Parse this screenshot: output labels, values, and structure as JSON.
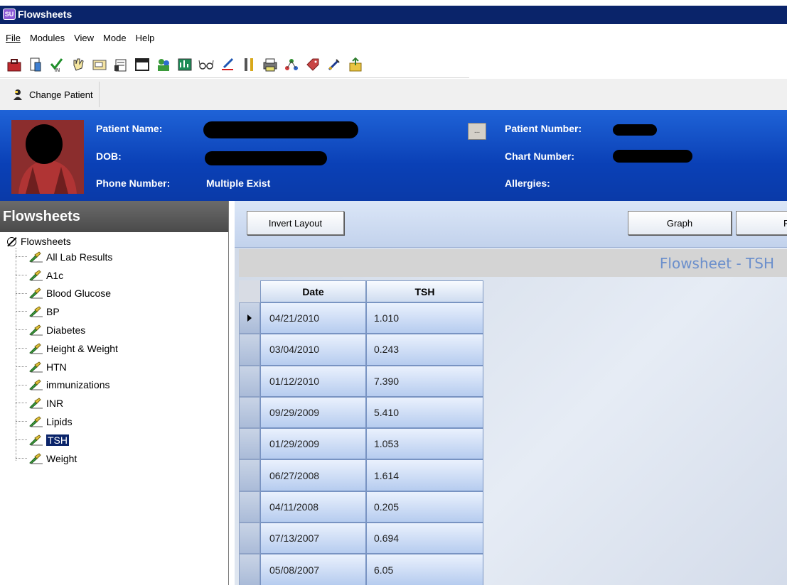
{
  "window": {
    "title": "Flowsheets",
    "icon_text": "SU"
  },
  "menu": [
    {
      "label": "File",
      "id": "file"
    },
    {
      "label": "Modules",
      "id": "modules"
    },
    {
      "label": "View",
      "id": "view"
    },
    {
      "label": "Mode",
      "id": "mode"
    },
    {
      "label": "Help",
      "id": "help"
    }
  ],
  "toolbar_icons": [
    "briefcase-icon",
    "document-icon",
    "checkmark-in-icon",
    "hand-icon",
    "folder-icon",
    "clipboard-icon",
    "window-icon",
    "people-icon",
    "chart-icon",
    "glasses-icon",
    "signature-icon",
    "tools-icon",
    "printer-icon",
    "network-icon",
    "tag-icon",
    "syringe-icon",
    "export-icon"
  ],
  "change_patient": {
    "label": "Change Patient"
  },
  "patient": {
    "name_label": "Patient Name:",
    "dob_label": "DOB:",
    "phone_label": "Phone Number:",
    "phone_value": "Multiple Exist",
    "number_label": "Patient Number:",
    "chart_label": "Chart Number:",
    "allergies_label": "Allergies:",
    "more_button": "..."
  },
  "left": {
    "title": "Flowsheets",
    "root": "Flowsheets",
    "items": [
      {
        "label": "All Lab Results"
      },
      {
        "label": "A1c"
      },
      {
        "label": "Blood Glucose"
      },
      {
        "label": "BP"
      },
      {
        "label": "Diabetes"
      },
      {
        "label": "Height & Weight"
      },
      {
        "label": "HTN"
      },
      {
        "label": "immunizations"
      },
      {
        "label": "INR"
      },
      {
        "label": "Lipids"
      },
      {
        "label": "TSH"
      },
      {
        "label": "Weight"
      }
    ],
    "selected_index": 10
  },
  "main": {
    "invert_button": "Invert Layout",
    "graph_button": "Graph",
    "print_button": "Pr",
    "sheet_title": "Flowsheet - TSH",
    "columns": [
      "Date",
      "TSH"
    ],
    "rows": [
      [
        "04/21/2010",
        "1.010"
      ],
      [
        "03/04/2010",
        "0.243"
      ],
      [
        "01/12/2010",
        "7.390"
      ],
      [
        "09/29/2009",
        "5.410"
      ],
      [
        "01/29/2009",
        "1.053"
      ],
      [
        "06/27/2008",
        "1.614"
      ],
      [
        "04/11/2008",
        "0.205"
      ],
      [
        "07/13/2007",
        "0.694"
      ],
      [
        "05/08/2007",
        "6.05"
      ]
    ],
    "current_row": 0
  }
}
